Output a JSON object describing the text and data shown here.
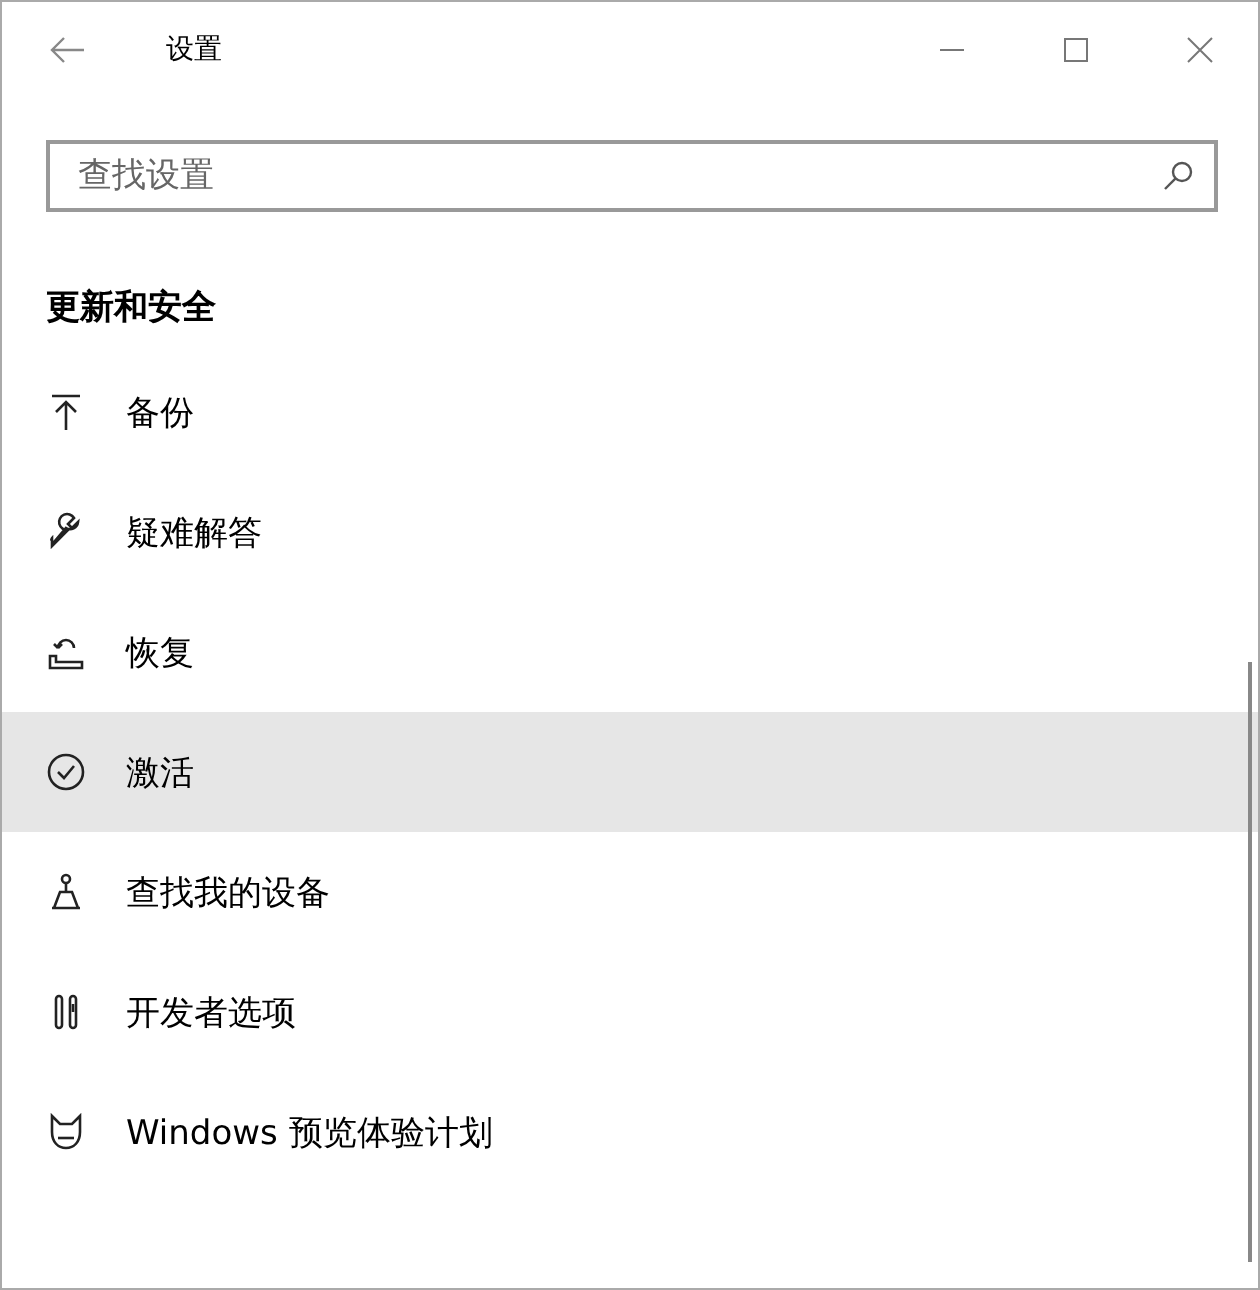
{
  "window": {
    "title": "设置"
  },
  "search": {
    "placeholder": "查找设置"
  },
  "section": {
    "heading": "更新和安全"
  },
  "items": [
    {
      "kind": "backup",
      "label": "备份",
      "selected": false
    },
    {
      "kind": "troubleshoot",
      "label": "疑难解答",
      "selected": false
    },
    {
      "kind": "recovery",
      "label": "恢复",
      "selected": false
    },
    {
      "kind": "activation",
      "label": "激活",
      "selected": true
    },
    {
      "kind": "find-device",
      "label": "查找我的设备",
      "selected": false
    },
    {
      "kind": "developer",
      "label": "开发者选项",
      "selected": false
    },
    {
      "kind": "insider",
      "label": "Windows 预览体验计划",
      "selected": false
    }
  ]
}
